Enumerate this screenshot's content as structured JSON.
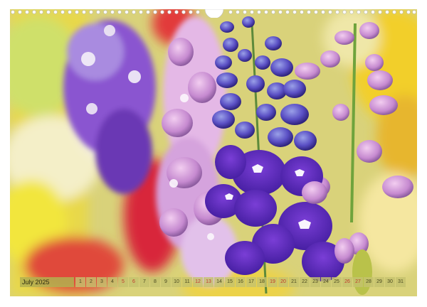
{
  "calendar": {
    "month_label": "July 2025",
    "days": [
      "1",
      "2",
      "3",
      "4",
      "5",
      "6",
      "7",
      "8",
      "9",
      "10",
      "11",
      "12",
      "13",
      "14",
      "15",
      "16",
      "17",
      "18",
      "19",
      "20",
      "21",
      "22",
      "23",
      "24",
      "25",
      "26",
      "27",
      "28",
      "29",
      "30",
      "31"
    ],
    "weekend_days": [
      "5",
      "6",
      "12",
      "13",
      "19",
      "20",
      "26",
      "27"
    ]
  },
  "photo": {
    "subject": "delphinium-flowers"
  }
}
